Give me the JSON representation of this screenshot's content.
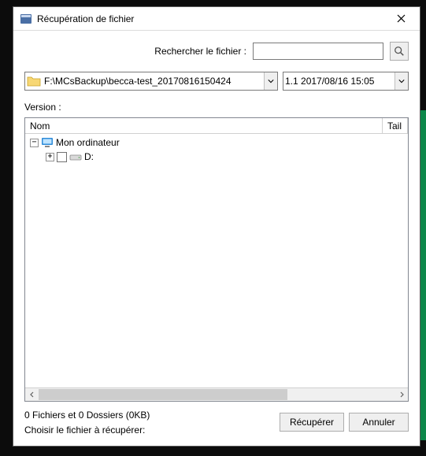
{
  "window": {
    "title": "Récupération de fichier"
  },
  "search": {
    "label": "Rechercher le fichier :",
    "value": ""
  },
  "pathCombo": {
    "value": "F:\\MCsBackup\\becca-test_20170816150424"
  },
  "versionCombo": {
    "value": "1.1  2017/08/16 15:05"
  },
  "versionLabel": "Version :",
  "columns": {
    "name": "Nom",
    "size": "Tail"
  },
  "tree": {
    "root": {
      "label": "Mon ordinateur",
      "expander": "−"
    },
    "child": {
      "label": "D:",
      "expander": "+"
    }
  },
  "footer": {
    "summary": "0 Fichiers et 0 Dossiers (0KB)",
    "hint": "Choisir le fichier à récupérer:",
    "recover": "Récupérer",
    "cancel": "Annuler"
  }
}
